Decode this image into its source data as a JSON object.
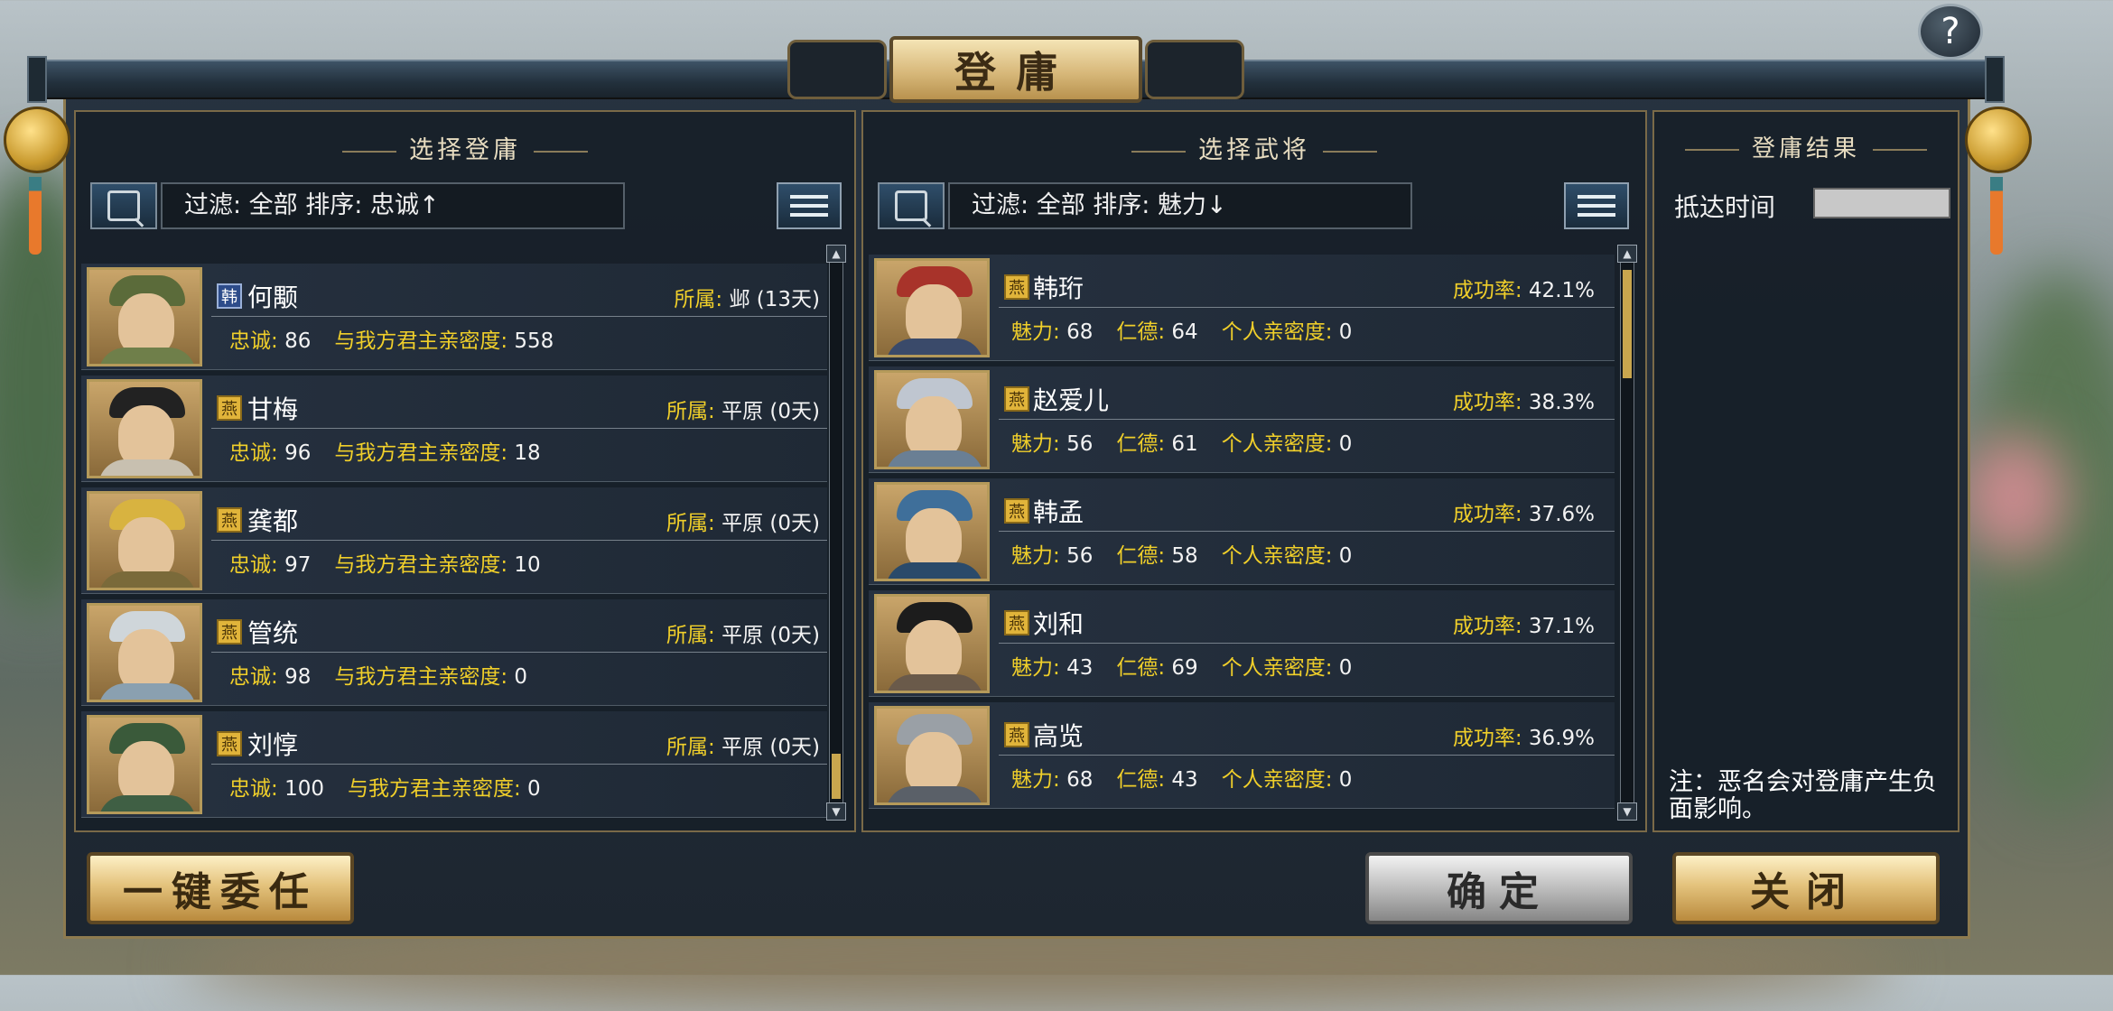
{
  "title": "登庸",
  "help_label": "?",
  "left_panel": {
    "title": "选择登庸",
    "filter_text": "过滤: 全部   排序: 忠诚↑",
    "affiliation_label": "所属:",
    "loyalty_label": "忠诚:",
    "intimacy_label": "与我方君主亲密度:",
    "rows": [
      {
        "faction": "韩",
        "faction_color": "blue",
        "name": "何颙",
        "affiliation": "邺 (13天)",
        "loyalty": "86",
        "intimacy": "558",
        "hat": "#5b6b3a",
        "robe": "#6f7f4a"
      },
      {
        "faction": "燕",
        "faction_color": "gold",
        "name": "甘梅",
        "affiliation": "平原 (0天)",
        "loyalty": "96",
        "intimacy": "18",
        "hat": "#222222",
        "robe": "#c8c0b0"
      },
      {
        "faction": "燕",
        "faction_color": "gold",
        "name": "龚都",
        "affiliation": "平原 (0天)",
        "loyalty": "97",
        "intimacy": "10",
        "hat": "#d8b340",
        "robe": "#7a6a3a"
      },
      {
        "faction": "燕",
        "faction_color": "gold",
        "name": "管统",
        "affiliation": "平原 (0天)",
        "loyalty": "98",
        "intimacy": "0",
        "hat": "#cfd6da",
        "robe": "#8aa0b0"
      },
      {
        "faction": "燕",
        "faction_color": "gold",
        "name": "刘惇",
        "affiliation": "平原 (0天)",
        "loyalty": "100",
        "intimacy": "0",
        "hat": "#3a5a3a",
        "robe": "#3f5f44"
      }
    ]
  },
  "middle_panel": {
    "title": "选择武将",
    "filter_text": "过滤: 全部   排序: 魅力↓",
    "success_label": "成功率:",
    "charm_label": "魅力:",
    "virtue_label": "仁德:",
    "intimacy_label": "个人亲密度:",
    "rows": [
      {
        "faction": "燕",
        "name": "韩珩",
        "success": "42.1%",
        "charm": "68",
        "virtue": "64",
        "intimacy": "0",
        "hat": "#a8332a",
        "robe": "#3a4a6a"
      },
      {
        "faction": "燕",
        "name": "赵爱儿",
        "success": "38.3%",
        "charm": "56",
        "virtue": "61",
        "intimacy": "0",
        "hat": "#bfc6d0",
        "robe": "#6a7f94"
      },
      {
        "faction": "燕",
        "name": "韩孟",
        "success": "37.6%",
        "charm": "56",
        "virtue": "58",
        "intimacy": "0",
        "hat": "#3f6f9a",
        "robe": "#2a4a6a"
      },
      {
        "faction": "燕",
        "name": "刘和",
        "success": "37.1%",
        "charm": "43",
        "virtue": "69",
        "intimacy": "0",
        "hat": "#1c1c1c",
        "robe": "#6a5a4a"
      },
      {
        "faction": "燕",
        "name": "高览",
        "success": "36.9%",
        "charm": "68",
        "virtue": "43",
        "intimacy": "0",
        "hat": "#9aa0a6",
        "robe": "#5a6068"
      }
    ]
  },
  "right_panel": {
    "title": "登庸结果",
    "arrival_label": "抵达时间",
    "arrival_value": "",
    "note": "注：恶名会对登庸产生负面影响。"
  },
  "buttons": {
    "auto_assign": "一键委任",
    "confirm": "确定",
    "close": "关闭"
  }
}
